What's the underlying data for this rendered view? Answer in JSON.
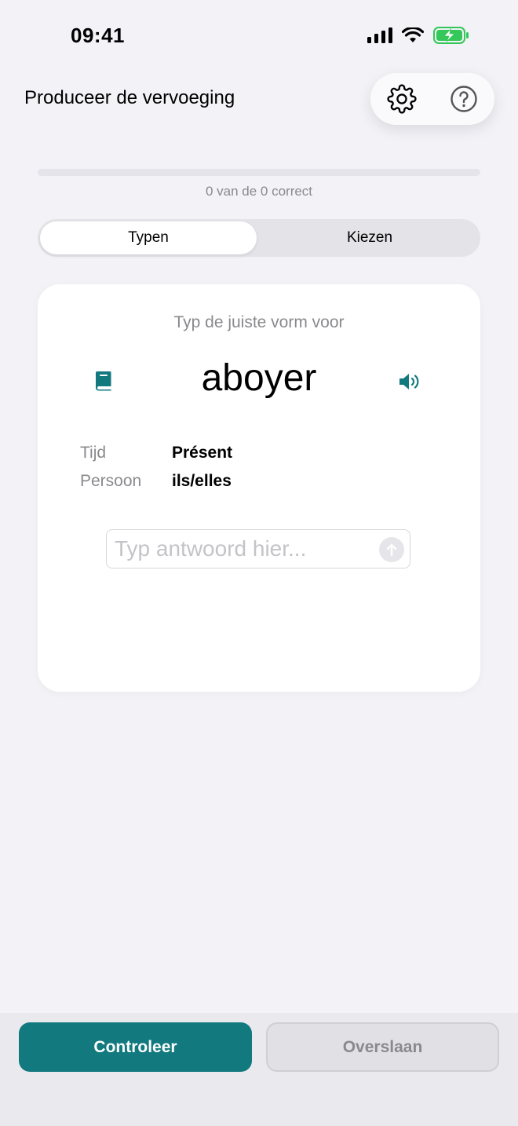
{
  "status_bar": {
    "time": "09:41",
    "icons": [
      "signal-icon",
      "wifi-icon",
      "battery-charging-icon"
    ],
    "battery_color": "#34C759"
  },
  "header": {
    "title": "Produceer de vervoeging",
    "actions": [
      "gear-icon",
      "help-icon"
    ]
  },
  "progress": {
    "text": "0 van de 0 correct",
    "fraction": 0
  },
  "mode_toggle": {
    "options": [
      "Typen",
      "Kiezen"
    ],
    "selected": "Typen"
  },
  "card": {
    "prompt": "Typ de juiste vorm voor",
    "verb": "aboyer",
    "details": [
      {
        "label": "Tijd",
        "value": "Présent"
      },
      {
        "label": "Persoon",
        "value": "ils/elles"
      }
    ],
    "answer_placeholder": "Typ antwoord hier...",
    "answer_value": "",
    "icons": [
      "book-icon",
      "speaker-icon",
      "arrow-up-icon"
    ]
  },
  "footer": {
    "primary_label": "Controleer",
    "secondary_label": "Overslaan"
  },
  "colors": {
    "accent": "#127A7F",
    "background": "#F2F2F7",
    "muted_text": "#8A8A8E"
  }
}
